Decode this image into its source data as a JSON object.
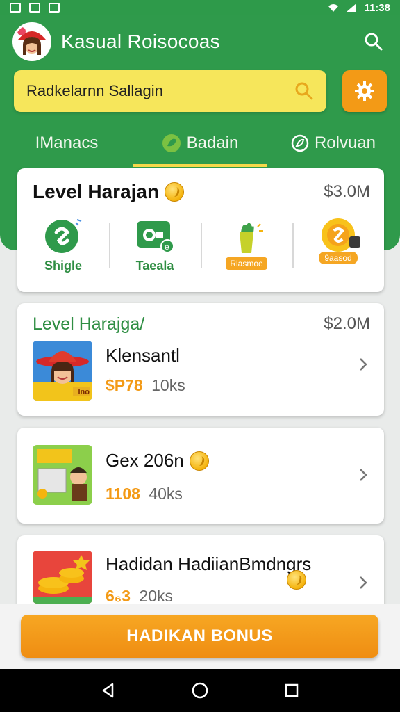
{
  "status_bar": {
    "time": "11:38"
  },
  "app": {
    "title": "Kasual Roisocoas"
  },
  "search": {
    "value": "Radkelarnn Sallagin"
  },
  "tabs": [
    {
      "label": "IManacs"
    },
    {
      "label": "Badain",
      "active": true
    },
    {
      "label": "Rolvuan"
    }
  ],
  "main_card": {
    "title": "Level Harajan",
    "amount": "$3.0M",
    "categories": [
      {
        "label": "Shigle",
        "tag": ""
      },
      {
        "label": "Taeala",
        "tag": ""
      },
      {
        "label": "",
        "tag": "Rlasmoe"
      },
      {
        "label": "",
        "tag": "9aasod"
      }
    ]
  },
  "list_card_a": {
    "level": "Level Harajga/",
    "level_amount": "$2.0M",
    "name": "Klensantl",
    "price": "$P78",
    "count": "10ks",
    "thumb_tag": "Ino"
  },
  "list_card_b": {
    "name": "Gex 206n",
    "price": "1108",
    "count": "40ks"
  },
  "list_card_c": {
    "name": "Hadidan HadiianBmdngrs",
    "price": "6₆3",
    "count": "20ks"
  },
  "bonus_button": {
    "label": "HADIKAN BONUS"
  },
  "colors": {
    "primary_green": "#2f9a4b",
    "accent_orange": "#f39a16",
    "search_yellow": "#f6e65b",
    "coin_gold": "#f5b40e"
  },
  "icons": [
    "avatar",
    "search-icon",
    "gear-icon",
    "chevron-right-icon",
    "back-icon",
    "home-icon",
    "recents-icon"
  ]
}
